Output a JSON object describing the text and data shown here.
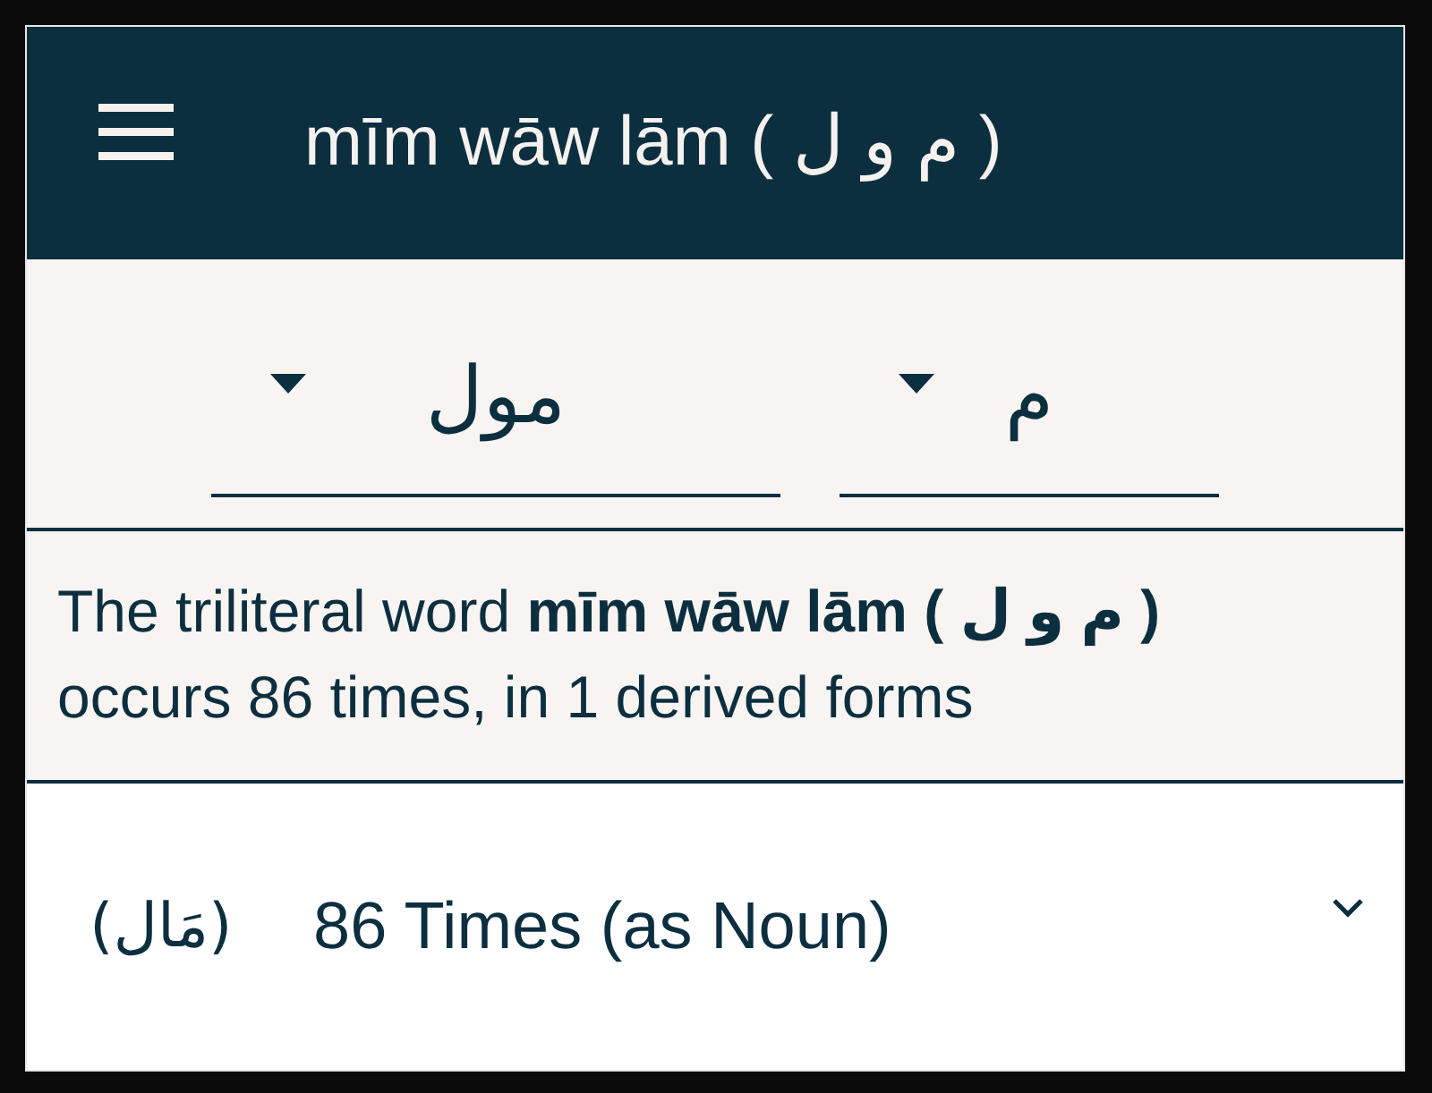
{
  "app_bar": {
    "title": "mīm wāw lām ( م و ل )"
  },
  "selectors": [
    {
      "value": "م"
    },
    {
      "value": "مول"
    }
  ],
  "summary": "The triliteral word **mīm wāw lām ( م و ل )** occurs 86 times, in 1 derived forms",
  "forms": [
    {
      "arabic": "(مَال)",
      "label": "86 Times (as Noun)",
      "expanded": false
    }
  ]
}
